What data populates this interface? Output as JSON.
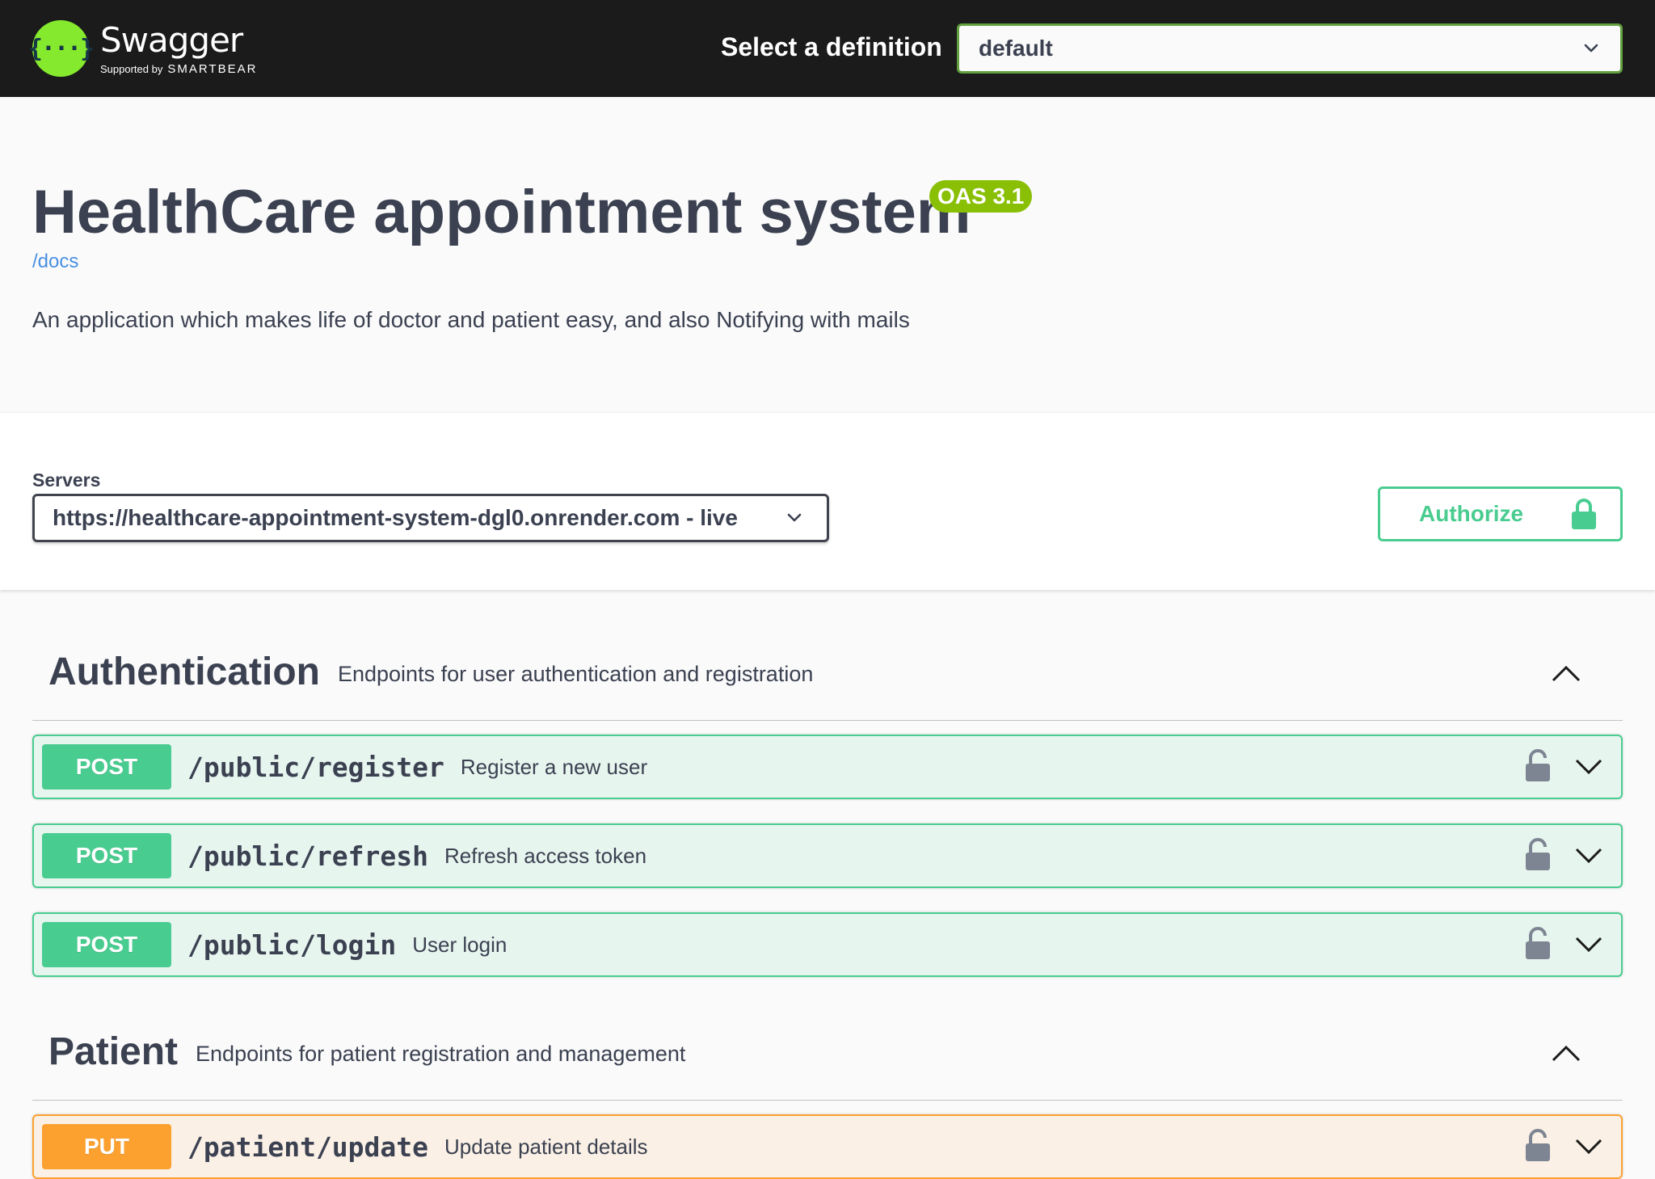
{
  "topbar": {
    "logo_icon": "{···}",
    "logo_name": "Swagger",
    "logo_supported": "Supported by",
    "logo_brand": "SMARTBEAR",
    "definition_label": "Select a definition",
    "definition_value": "default"
  },
  "info": {
    "title": "HealthCare appointment system",
    "version_badge": "OAS 3.1",
    "docs_link": "/docs",
    "description": "An application which makes life of doctor and patient easy, and also Notifying with mails"
  },
  "scheme": {
    "servers_label": "Servers",
    "server_value": "https://healthcare-appointment-system-dgl0.onrender.com - live",
    "authorize_label": "Authorize"
  },
  "tags": [
    {
      "name": "Authentication",
      "description": "Endpoints for user authentication and registration",
      "operations": [
        {
          "method": "POST",
          "path": "/public/register",
          "summary": "Register a new user"
        },
        {
          "method": "POST",
          "path": "/public/refresh",
          "summary": "Refresh access token"
        },
        {
          "method": "POST",
          "path": "/public/login",
          "summary": "User login"
        }
      ]
    },
    {
      "name": "Patient",
      "description": "Endpoints for patient registration and management",
      "operations": [
        {
          "method": "PUT",
          "path": "/patient/update",
          "summary": "Update patient details"
        }
      ]
    }
  ],
  "colors": {
    "post": "#49cc90",
    "put": "#fca130",
    "accent_green": "#85ea2d",
    "oas_badge": "#89bf04",
    "link": "#4990e2"
  },
  "icons": {
    "logo": "swagger-logo-icon",
    "dropdown": "chevron-down-icon",
    "lock": "lock-icon",
    "collapse": "chevron-up-icon"
  }
}
